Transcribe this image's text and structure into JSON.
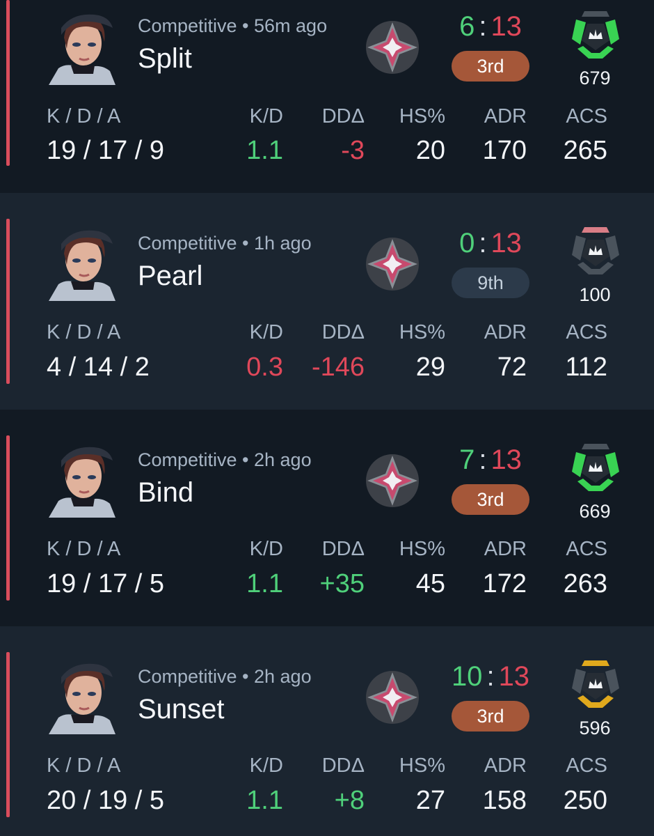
{
  "colors": {
    "win": "#4fd07a",
    "loss": "#e0485a",
    "placement_bronze": "#a55739",
    "placement_slate": "#2c3a4a",
    "rr_green": "#39d353",
    "rr_grey": "#4a535c",
    "rr_pink": "#d87d86",
    "rr_gold": "#e0a91d"
  },
  "column_labels": {
    "kda": "K / D / A",
    "kd": "K/D",
    "dda": "DDΔ",
    "hs": "HS%",
    "adr": "ADR",
    "acs": "ACS"
  },
  "matches": [
    {
      "meta": "Competitive • 56m ago",
      "map": "Split",
      "score_team": "6",
      "score_enemy": "13",
      "placement": "3rd",
      "rr": "679",
      "rr_icon": "green-rank-badge-icon",
      "kda": "19 / 17 / 9",
      "kd": "1.1",
      "dda": "-3",
      "hs": "20",
      "adr": "170",
      "acs": "265"
    },
    {
      "meta": "Competitive • 1h ago",
      "map": "Pearl",
      "score_team": "0",
      "score_enemy": "13",
      "placement": "9th",
      "rr": "100",
      "rr_icon": "grey-rank-badge-icon",
      "kda": "4 / 14 / 2",
      "kd": "0.3",
      "dda": "-146",
      "hs": "29",
      "adr": "72",
      "acs": "112"
    },
    {
      "meta": "Competitive • 2h ago",
      "map": "Bind",
      "score_team": "7",
      "score_enemy": "13",
      "placement": "3rd",
      "rr": "669",
      "rr_icon": "green-rank-badge-icon",
      "kda": "19 / 17 / 5",
      "kd": "1.1",
      "dda": "+35",
      "hs": "45",
      "adr": "172",
      "acs": "263"
    },
    {
      "meta": "Competitive • 2h ago",
      "map": "Sunset",
      "score_team": "10",
      "score_enemy": "13",
      "placement": "3rd",
      "rr": "596",
      "rr_icon": "gold-rank-badge-icon",
      "kda": "20 / 19 / 5",
      "kd": "1.1",
      "dda": "+8",
      "hs": "27",
      "adr": "158",
      "acs": "250"
    }
  ]
}
